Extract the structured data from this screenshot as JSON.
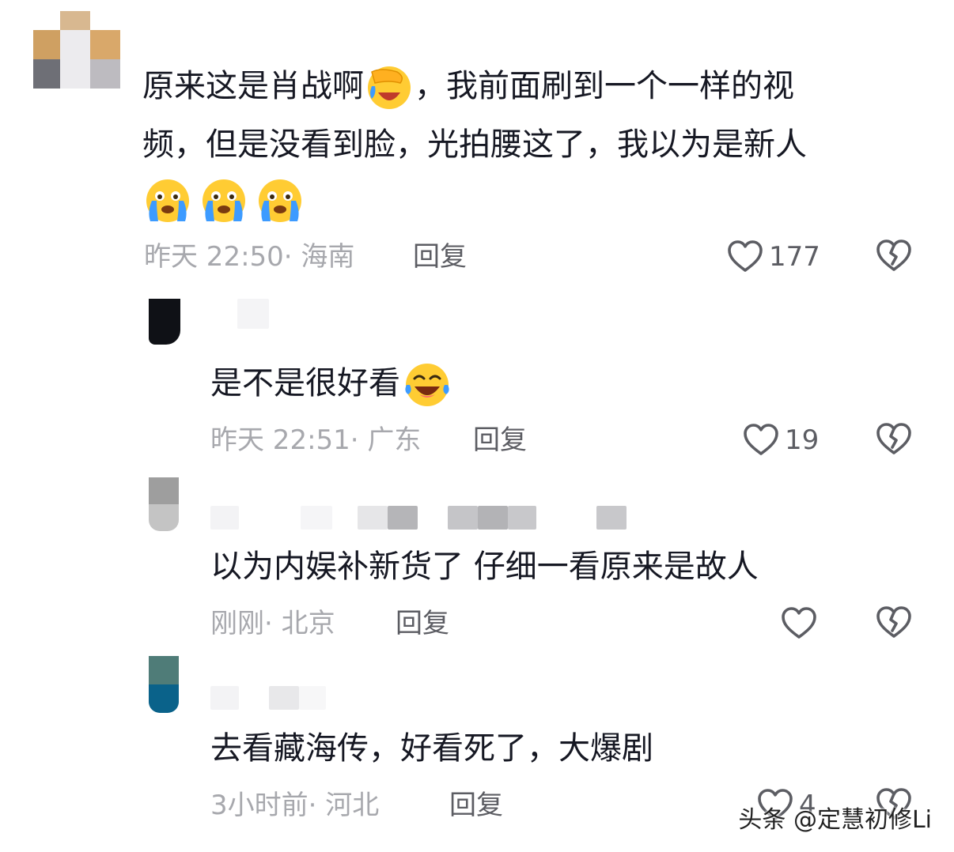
{
  "comments": [
    {
      "text_line1": "原来这是肖战啊",
      "text_line1b": "，我前面刷到一个一样的视",
      "text_line2": "频，但是没看到脸，光拍腰这了，我以为是新人",
      "time": "昨天 22:50",
      "location": "· 海南",
      "reply": "回复",
      "likes": "177"
    },
    {
      "text": "是不是很好看",
      "time": "昨天 22:51",
      "location": "· 广东",
      "reply": "回复",
      "likes": "19"
    },
    {
      "text": "以为内娱补新货了 仔细一看原来是故人",
      "time": "刚刚",
      "location": "· 北京",
      "reply": "回复",
      "likes": ""
    },
    {
      "text": "去看藏海传，好看死了，大爆剧",
      "time": "3小时前",
      "location": "· 河北",
      "reply": "回复",
      "likes": "4"
    }
  ],
  "watermark": "头条 @定慧初修Li",
  "icons": {
    "like": "heart-outline-icon",
    "dislike": "broken-heart-icon",
    "emoji_facepalm": "facepalm-emoji-icon",
    "emoji_cry": "crying-emoji-icon",
    "emoji_laugh": "laughing-tears-emoji-icon"
  },
  "colors": {
    "text": "#161823",
    "meta": "#a7a8ad",
    "action": "#5c5d63"
  }
}
